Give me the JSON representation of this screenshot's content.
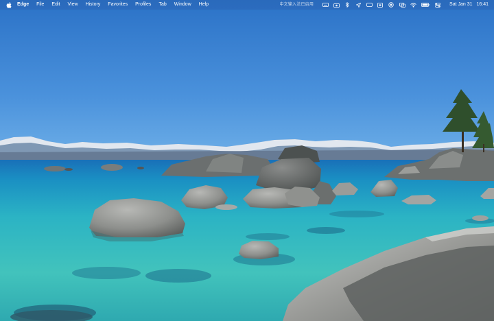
{
  "menubar": {
    "app_name": "Edge",
    "items": [
      "File",
      "Edit",
      "View",
      "History",
      "Favorites",
      "Profiles",
      "Tab",
      "Window",
      "Help"
    ],
    "ime_text": "中文输入法已启用",
    "status_icons": [
      "keyboard-icon",
      "camera-icon",
      "bluetooth-icon",
      "location-icon",
      "messages-icon",
      "screenshot-icon",
      "record-icon",
      "display-icon",
      "wifi-icon",
      "battery-icon",
      "control-center-icon"
    ],
    "date": "Sat Jan 31",
    "time": "16:41"
  },
  "wallpaper": {
    "description_colors": {
      "sky_top": "#2d73c9",
      "sky_bottom": "#5fa2e5",
      "water_deep": "#1f7fc0",
      "water_shallow": "#49c3c4"
    }
  }
}
